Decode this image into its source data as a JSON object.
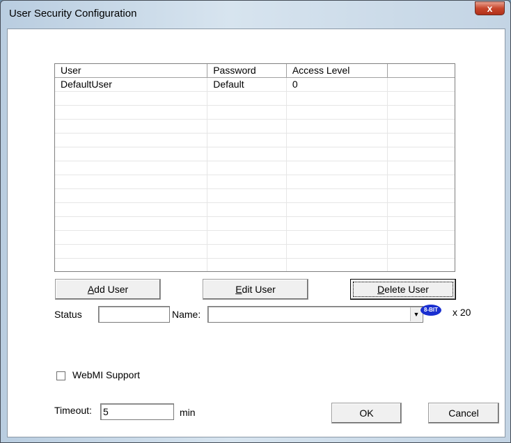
{
  "window": {
    "title": "User Security Configuration",
    "close_glyph": "x"
  },
  "table": {
    "headers": [
      "User",
      "Password",
      "Access Level",
      ""
    ],
    "rows": [
      [
        "DefaultUser",
        "Default",
        "0",
        ""
      ],
      [
        "",
        "",
        "",
        ""
      ],
      [
        "",
        "",
        "",
        ""
      ],
      [
        "",
        "",
        "",
        ""
      ],
      [
        "",
        "",
        "",
        ""
      ],
      [
        "",
        "",
        "",
        ""
      ],
      [
        "",
        "",
        "",
        ""
      ],
      [
        "",
        "",
        "",
        ""
      ],
      [
        "",
        "",
        "",
        ""
      ],
      [
        "",
        "",
        "",
        ""
      ],
      [
        "",
        "",
        "",
        ""
      ],
      [
        "",
        "",
        "",
        ""
      ],
      [
        "",
        "",
        "",
        ""
      ],
      [
        "",
        "",
        "",
        ""
      ]
    ]
  },
  "buttons": {
    "add_user": {
      "mnemonic": "A",
      "rest": "dd User"
    },
    "edit_user": {
      "mnemonic": "E",
      "rest": "dit User"
    },
    "delete_user": {
      "mnemonic": "D",
      "rest": "elete User"
    },
    "ok": "OK",
    "cancel": "Cancel"
  },
  "status": {
    "label": "Status",
    "value": ""
  },
  "name": {
    "label": "Name:",
    "value": "",
    "arrow": "▼"
  },
  "bits": {
    "icon_text": "8-BIT",
    "multiplier": "x  20"
  },
  "webmi": {
    "label": "WebMI Support",
    "checked": false
  },
  "timeout": {
    "label": "Timeout:",
    "value": "5",
    "unit": "min"
  }
}
